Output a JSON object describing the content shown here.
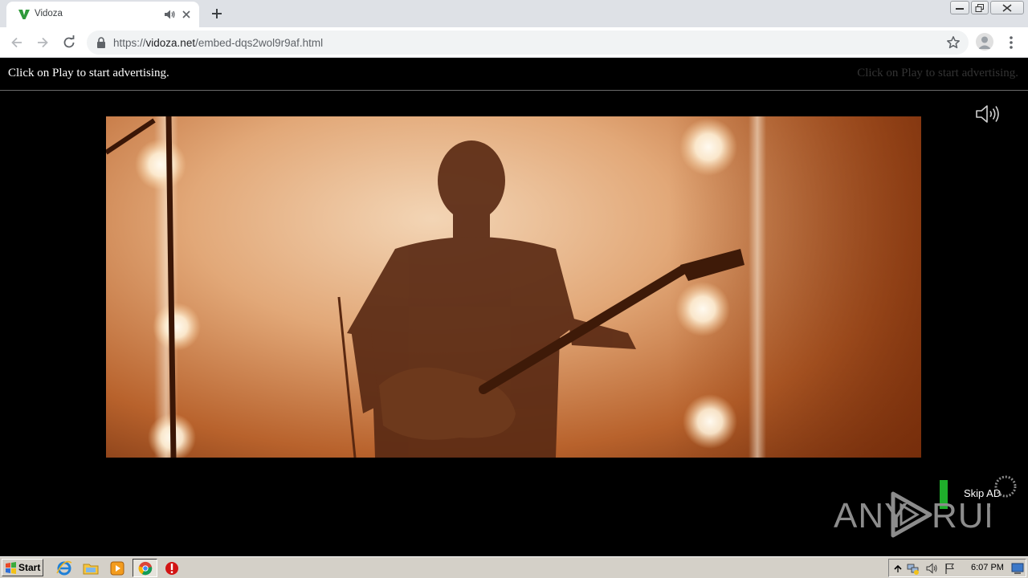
{
  "browser": {
    "tab": {
      "title": "Vidoza",
      "favicon": "vidoza-v-logo",
      "audio_indicator": "speaker-icon"
    },
    "url": {
      "scheme": "https://",
      "host": "vidoza.net",
      "path": "/embed-dqs2wol9r9af.html"
    }
  },
  "page": {
    "ad_text_left": "Click on Play to start advertising.",
    "ad_text_right": "Click on Play to start advertising.",
    "skip_label": "Skip AD",
    "watermark": "ANY RUN"
  },
  "taskbar": {
    "start_label": "Start",
    "apps": [
      "internet-explorer-icon",
      "file-explorer-icon",
      "media-player-icon",
      "chrome-icon",
      "stop-icon"
    ],
    "clock": "6:07 PM"
  },
  "colors": {
    "skip_indicator": "#1fae2b",
    "tab_strip": "#dee1e6",
    "video_warm": "#e2a878"
  }
}
